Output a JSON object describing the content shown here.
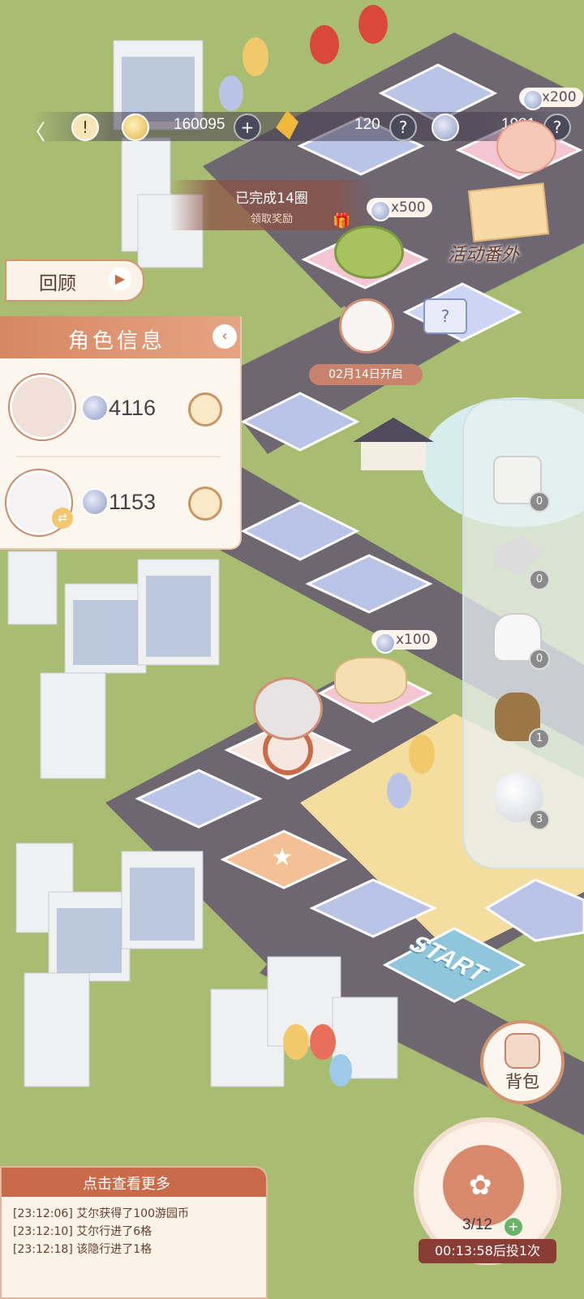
{
  "hud": {
    "currency1": "160095",
    "currency2": "120",
    "currency3": "1931",
    "currency4_partial": "x200",
    "back_icon": "back-arrow-icon",
    "alert_icon": "exclamation-icon"
  },
  "progress": {
    "laps": "已完成14圈",
    "reward_hint": "领取奖励"
  },
  "buttons": {
    "review": "回顾",
    "backpack": "背包",
    "event_special": "活动番外"
  },
  "role_panel": {
    "title": "角色信息",
    "roles": [
      {
        "coins": "4116"
      },
      {
        "coins": "1153"
      }
    ]
  },
  "board": {
    "reward_500": "x500",
    "reward_100": "x100",
    "unlock_date": "02月14日开启",
    "start_label": "START"
  },
  "side_items": [
    {
      "name": "dice",
      "count": "0"
    },
    {
      "name": "shuffle",
      "count": "0"
    },
    {
      "name": "glove",
      "count": "0"
    },
    {
      "name": "sack",
      "count": "1"
    },
    {
      "name": "snowball",
      "count": "3"
    }
  ],
  "log": {
    "header": "点击查看更多",
    "lines": [
      "[23:12:06] 艾尔获得了100游园币",
      "[23:12:10] 艾尔行进了6格",
      "[23:12:18] 该隐行进了1格"
    ]
  },
  "roll": {
    "counter": "3/12",
    "timer": "00:13:58后投1次"
  },
  "colors": {
    "grass": "#a9bd72",
    "road": "#6e6670",
    "tile": "#b9c3e6",
    "accent": "#c96b49",
    "panel": "#fbf6ee"
  }
}
